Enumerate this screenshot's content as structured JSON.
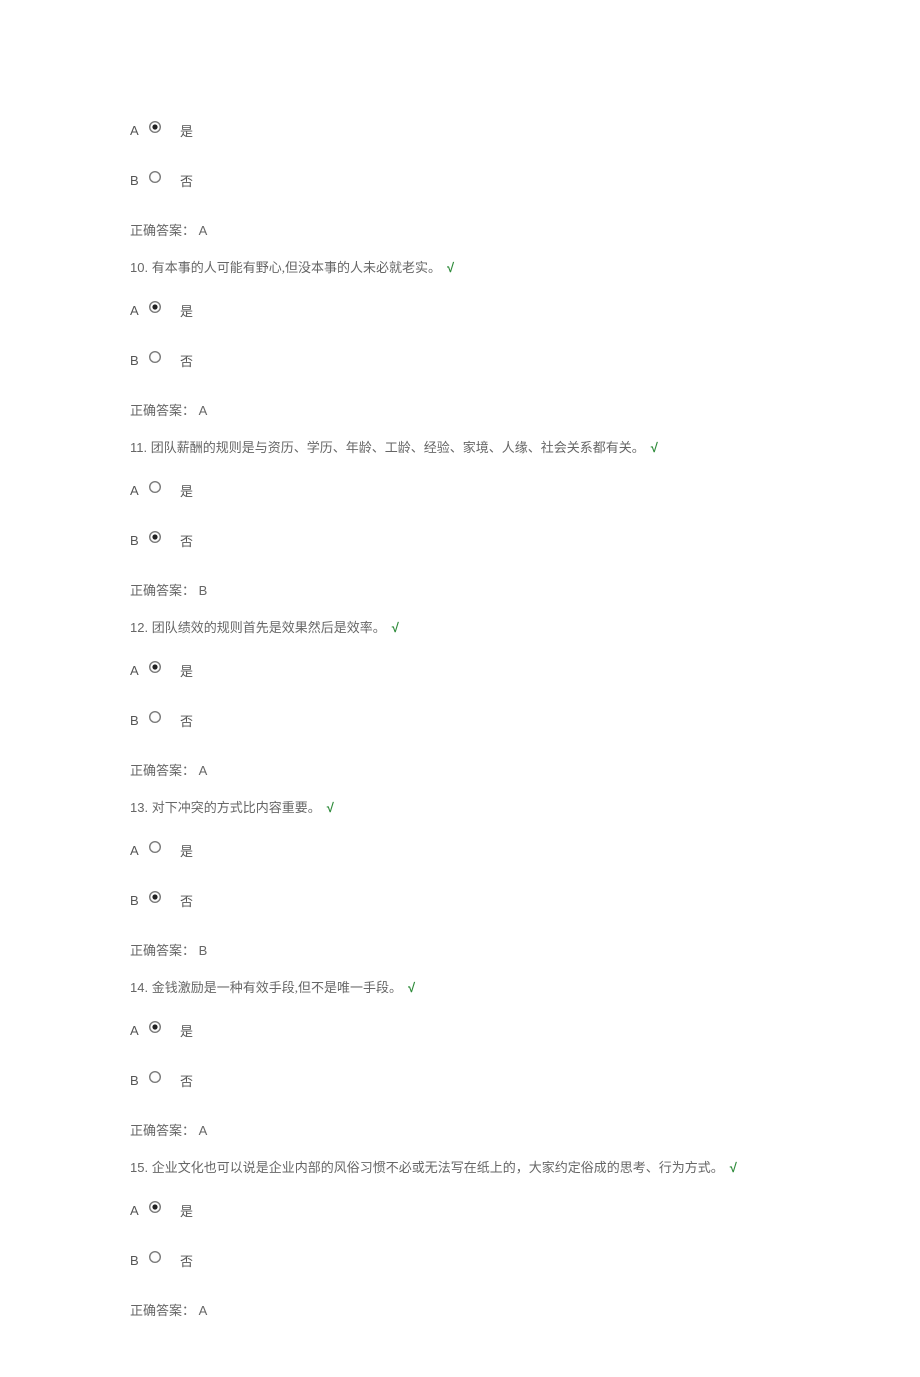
{
  "labels": {
    "option_a": "A",
    "option_b": "B",
    "yes": "是",
    "no": "否",
    "correct_prefix": "正确答案：",
    "check": "√"
  },
  "leading": {
    "selected": "A",
    "correct": "A"
  },
  "questions": [
    {
      "num": "10.",
      "text": "有本事的人可能有野心,但没本事的人未必就老实。",
      "selected": "A",
      "correct": "A"
    },
    {
      "num": "11.",
      "text": "团队薪酬的规则是与资历、学历、年龄、工龄、经验、家境、人缘、社会关系都有关。",
      "selected": "B",
      "correct": "B"
    },
    {
      "num": "12.",
      "text": "团队绩效的规则首先是效果然后是效率。",
      "selected": "A",
      "correct": "A"
    },
    {
      "num": "13.",
      "text": "对下冲突的方式比内容重要。",
      "selected": "B",
      "correct": "B"
    },
    {
      "num": "14.",
      "text": "金钱激励是一种有效手段,但不是唯一手段。",
      "selected": "A",
      "correct": "A"
    },
    {
      "num": "15.",
      "text": "企业文化也可以说是企业内部的风俗习惯不必或无法写在纸上的，大家约定俗成的思考、行为方式。",
      "selected": "A",
      "correct": "A"
    }
  ]
}
